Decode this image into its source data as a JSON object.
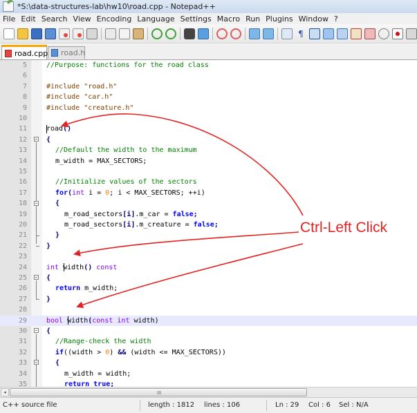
{
  "window": {
    "title": "*S:\\data-structures-lab\\hw10\\road.cpp - Notepad++"
  },
  "menu": [
    "File",
    "Edit",
    "Search",
    "View",
    "Encoding",
    "Language",
    "Settings",
    "Macro",
    "Run",
    "Plugins",
    "Window",
    "?"
  ],
  "toolbar": {
    "icons": [
      "new-file-icon",
      "open-file-icon",
      "save-icon",
      "save-all-icon",
      "close-icon",
      "close-all-icon",
      "print-icon",
      "cut-icon",
      "copy-icon",
      "paste-icon",
      "undo-icon",
      "redo-icon",
      "find-icon",
      "replace-icon",
      "zoom-in-icon",
      "zoom-out-icon",
      "sync-vertical-icon",
      "sync-horizontal-icon",
      "word-wrap-icon",
      "show-all-chars-icon",
      "indent-guide-icon",
      "user-language-icon",
      "doc-map-icon",
      "function-list-icon",
      "monitor-icon",
      "record-macro-icon",
      "stop-macro-icon"
    ]
  },
  "tabs": [
    {
      "label": "road.cpp",
      "active": true,
      "icon": "red-file-icon"
    },
    {
      "label": "road.h",
      "active": false,
      "icon": "blue-file-icon"
    }
  ],
  "editor": {
    "highlighted_line": 29,
    "lines": [
      {
        "n": "5"
      },
      {
        "n": "6"
      },
      {
        "n": "7"
      },
      {
        "n": "8"
      },
      {
        "n": "9"
      },
      {
        "n": "10"
      },
      {
        "n": "11"
      },
      {
        "n": "12"
      },
      {
        "n": "13"
      },
      {
        "n": "14"
      },
      {
        "n": "15"
      },
      {
        "n": "16"
      },
      {
        "n": "17"
      },
      {
        "n": "18"
      },
      {
        "n": "19"
      },
      {
        "n": "20"
      },
      {
        "n": "21"
      },
      {
        "n": "22"
      },
      {
        "n": "23"
      },
      {
        "n": "24"
      },
      {
        "n": "25"
      },
      {
        "n": "26"
      },
      {
        "n": "27"
      },
      {
        "n": "28"
      },
      {
        "n": "29"
      },
      {
        "n": "30"
      },
      {
        "n": "31"
      },
      {
        "n": "32"
      },
      {
        "n": "33"
      },
      {
        "n": "34"
      },
      {
        "n": "35"
      }
    ],
    "code": {
      "l5": "//Purpose: functions for the road class",
      "l7_kw": "#include",
      "l7_str": "\"road.h\"",
      "l8_str": "\"car.h\"",
      "l9_str": "\"creature.h\"",
      "l11_name": "road",
      "l11_paren": "()",
      "l12": "{",
      "l13": "//Default the width to the maximum",
      "l14": "m_width = MAX_SECTORS;",
      "l16": "//Initialize values of the sectors",
      "l17_kw": "for",
      "l17_open": "(",
      "l17_type": "int",
      "l17_a": " i = ",
      "l17_zero": "0",
      "l17_b": "; i < MAX_SECTORS; ++i)",
      "l18": "{",
      "l19_a": "m_road_sectors",
      "l19_b": "[i]",
      "l19_c": ".m_car = ",
      "l19_d": "false",
      "l19_e": ";",
      "l20_c": ".m_creature = ",
      "l21": "}",
      "l22": "}",
      "l24_type": "int",
      "l24_name": "width",
      "l24_paren": "()",
      "l24_const": "const",
      "l25": "{",
      "l26_kw": "return",
      "l26_rest": " m_width;",
      "l27": "}",
      "l29_type": "bool",
      "l29_name": "width",
      "l29_open": "(",
      "l29_const": "const",
      "l29_int": "int",
      "l29_rest": " width)",
      "l30": "{",
      "l31": "//Range-check the width",
      "l32_kw": "if",
      "l32_a": "((width > ",
      "l32_zero": "0",
      "l32_b": ") ",
      "l32_and": "&&",
      "l32_c": " (width <= MAX_SECTORS))",
      "l33": "{",
      "l34": "m_width = width;",
      "l35_kw": "return",
      "l35_val": "true",
      "l35_end": ";"
    }
  },
  "annotation": {
    "callout_text": "Ctrl-Left Click",
    "color": "#e32121"
  },
  "scrollbar": {
    "left_arrow": "◂",
    "grip": "III"
  },
  "status": {
    "lang": "C++ source file",
    "length": "length : 1812",
    "lines": "lines : 106",
    "ln": "Ln : 29",
    "col": "Col : 6",
    "sel": "Sel : N/A"
  }
}
